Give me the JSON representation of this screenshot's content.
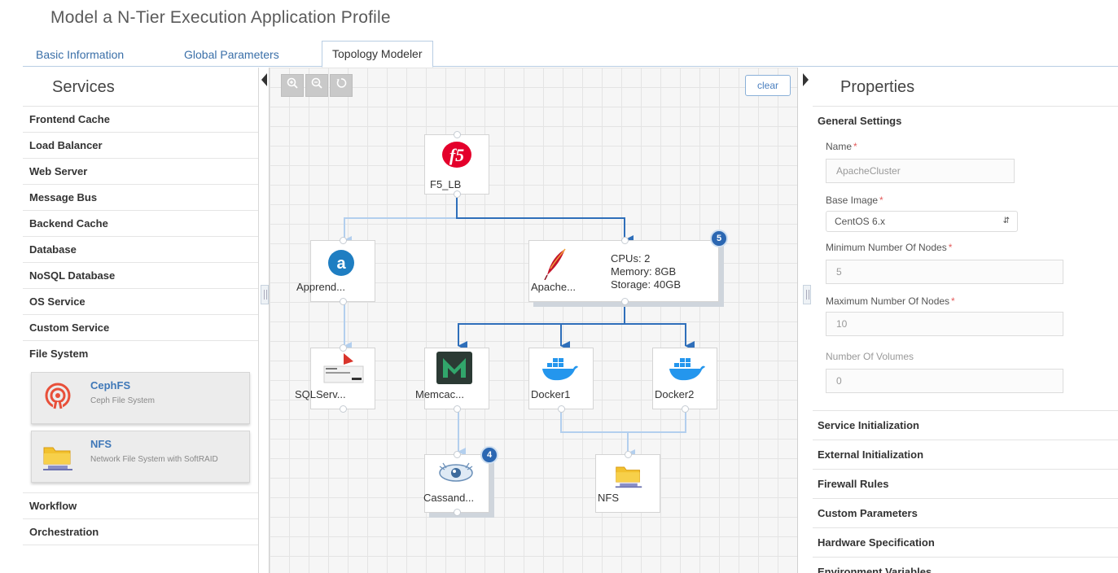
{
  "page": {
    "title": "Model a N-Tier Execution Application Profile"
  },
  "tabs": [
    {
      "label": "Basic Information"
    },
    {
      "label": "Global Parameters"
    },
    {
      "label": "Topology Modeler"
    }
  ],
  "services": {
    "title": "Services",
    "items": [
      {
        "label": "Frontend Cache"
      },
      {
        "label": "Load Balancer"
      },
      {
        "label": "Web Server"
      },
      {
        "label": "Message Bus"
      },
      {
        "label": "Backend Cache"
      },
      {
        "label": "Database"
      },
      {
        "label": "NoSQL Database"
      },
      {
        "label": "OS Service"
      },
      {
        "label": "Custom Service"
      },
      {
        "label": "File System"
      }
    ],
    "file_system_items": [
      {
        "name": "CephFS",
        "desc": "Ceph File System",
        "icon": "ceph-icon"
      },
      {
        "name": "NFS",
        "desc": "Network File System with SoftRAID",
        "icon": "folder-icon"
      }
    ],
    "bottom_items": [
      {
        "label": "Workflow"
      },
      {
        "label": "Orchestration"
      }
    ]
  },
  "toolbar": {
    "zoom_in": "zoom-in-icon",
    "zoom_out": "zoom-out-icon",
    "reset": "reset-icon",
    "clear_label": "clear"
  },
  "topology": {
    "nodes": {
      "f5": {
        "label": "F5_LB",
        "icon": "f5-logo-icon"
      },
      "appr": {
        "label": "Apprend...",
        "icon": "apprenda-icon"
      },
      "apache": {
        "label": "Apache...",
        "icon": "apache-feather-icon",
        "cpus": "CPUs: 2",
        "memory": "Memory: 8GB",
        "storage": "Storage: 40GB",
        "badge": "5"
      },
      "sql": {
        "label": "SQLServ...",
        "icon": "sqlserver-icon"
      },
      "memcache": {
        "label": "Memcac...",
        "icon": "memcached-icon"
      },
      "docker1": {
        "label": "Docker1",
        "icon": "docker-whale-icon"
      },
      "docker2": {
        "label": "Docker2",
        "icon": "docker-whale-icon"
      },
      "cassandra": {
        "label": "Cassand...",
        "icon": "cassandra-eye-icon",
        "badge": "4"
      },
      "nfs": {
        "label": "NFS",
        "icon": "folder-icon"
      }
    }
  },
  "properties": {
    "title": "Properties",
    "general_settings": "General Settings",
    "fields": {
      "name_label": "Name",
      "name_value": "ApacheCluster",
      "base_image_label": "Base Image",
      "base_image_value": "CentOS 6.x",
      "min_nodes_label": "Minimum Number Of Nodes",
      "min_nodes_value": "5",
      "max_nodes_label": "Maximum Number Of Nodes",
      "max_nodes_value": "10",
      "volumes_label": "Number Of Volumes",
      "volumes_value": "0",
      "required_marker": "*"
    },
    "sections": [
      {
        "label": "Service Initialization"
      },
      {
        "label": "External Initialization"
      },
      {
        "label": "Firewall Rules"
      },
      {
        "label": "Custom Parameters"
      },
      {
        "label": "Hardware Specification"
      },
      {
        "label": "Environment Variables"
      }
    ]
  },
  "colors": {
    "accent": "#3a6fa8",
    "link_light": "#b3cfee",
    "link_dark": "#2f6fba",
    "badge": "#2b67b2",
    "required": "#e45c5c"
  }
}
